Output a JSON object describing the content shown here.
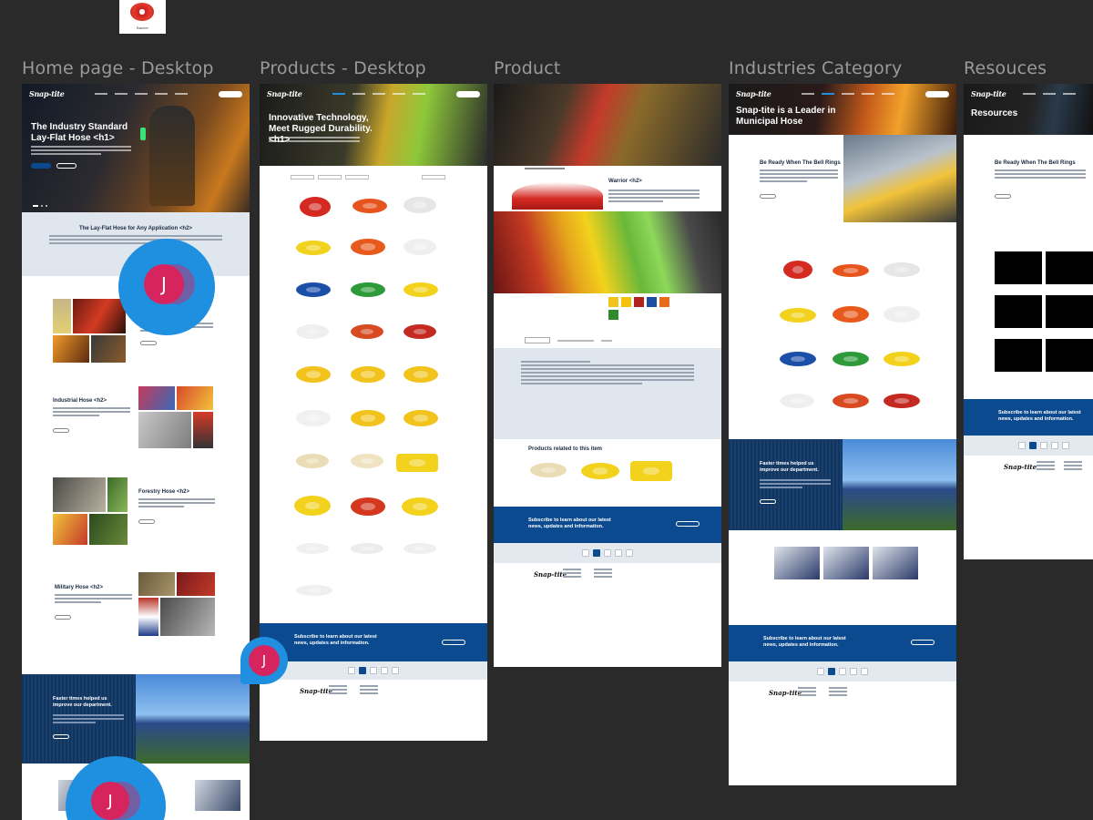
{
  "thumbnail": {
    "caption": "Banner"
  },
  "frames": {
    "home": {
      "label": "Home page - Desktop",
      "logo": "Snap-tite",
      "hero_title": "The Industry Standard Lay-Flat Hose <h1>",
      "section1_title": "The Lay-Flat Hose for Any Application <h2>",
      "industrial_title": "Industrial Hose <h2>",
      "forestry_title": "Forestry Hose <h2>",
      "military_title": "Military Hose <h2>",
      "faster_title": "Faster times helped us improve our department."
    },
    "products": {
      "label": "Products - Desktop",
      "logo": "Snap-tite",
      "hero_title": "Innovative Technology, Meet Rugged Durability.<h1>",
      "subscribe": "Subscribe to learn about our latest news, updates and information.",
      "footer_logo": "Snap-tite"
    },
    "product": {
      "label": "Product",
      "product_title": "Warrior <h2>",
      "related_title": "Products related to this item",
      "subscribe": "Subscribe to learn about our latest news, updates and information.",
      "footer_logo": "Snap-tite",
      "swatch_colors": [
        "#f0c419",
        "#f4c20d",
        "#b0231c",
        "#1d4fa0",
        "#e86a1c",
        "#2f8a2e"
      ]
    },
    "industries": {
      "label": "Industries Category",
      "logo": "Snap-tite",
      "hero_title": "Snap-tite is a Leader in Municipal Hose",
      "bell_title": "Be Ready When The Bell Rings",
      "faster_title": "Faster times helped us improve our department.",
      "subscribe": "Subscribe to learn about our latest news, updates and information.",
      "footer_logo": "Snap-tite"
    },
    "resources": {
      "label": "Resouces",
      "logo": "Snap-tite",
      "hero_title": "Resources",
      "bell_title": "Be Ready When The Bell Rings",
      "subscribe": "Subscribe to learn about our latest news, updates and information.",
      "footer_logo": "Snap-tite"
    }
  },
  "avatars": {
    "initial": "J"
  },
  "colors": {
    "canvas": "#2a2a2a",
    "brand_blue": "#0b4a8e",
    "avatar_blue": "#1f8fe0",
    "avatar_pink": "#d6245e"
  }
}
